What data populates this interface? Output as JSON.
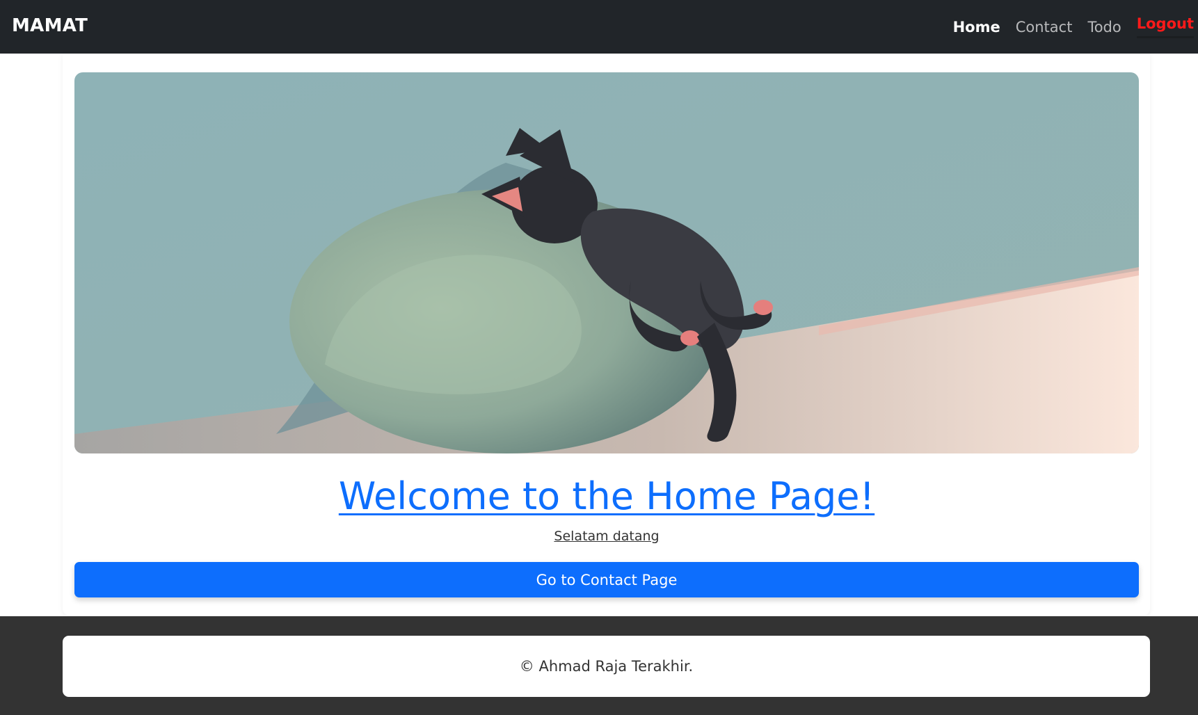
{
  "navbar": {
    "brand": "MAMAT",
    "links": [
      {
        "label": "Home",
        "active": true
      },
      {
        "label": "Contact"
      },
      {
        "label": "Todo"
      },
      {
        "label": "Logout",
        "color": "#ff1a1a"
      }
    ]
  },
  "hero": {
    "image_subject": "cat-sleeping-on-cushion-illustration"
  },
  "main": {
    "title": "Welcome to the Home Page!",
    "subtitle": "Selatam datang",
    "button_label": "Go to Contact Page"
  },
  "footer": {
    "text": "© Ahmad Raja Terakhir."
  },
  "colors": {
    "navbar_bg": "#212529",
    "primary": "#0d6efd",
    "logout": "#ff1a1a",
    "page_bg": "#333333"
  }
}
